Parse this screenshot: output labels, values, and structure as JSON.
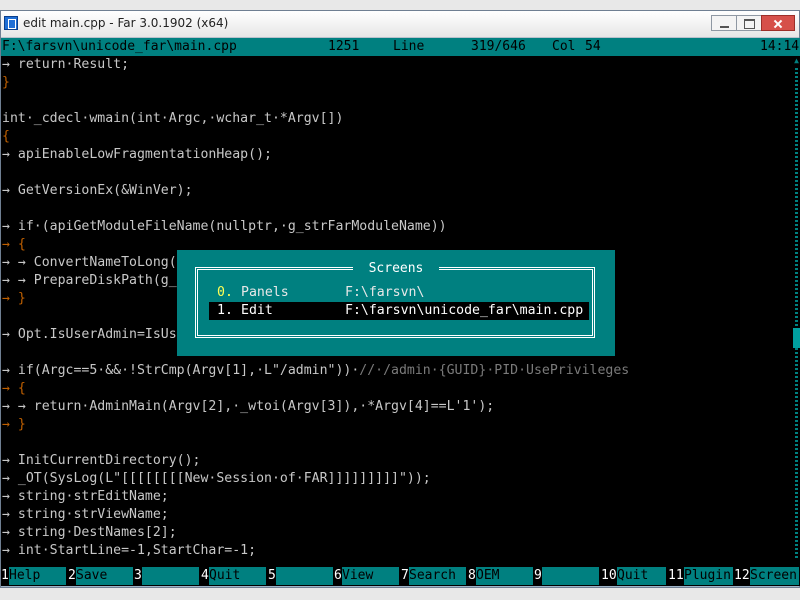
{
  "window": {
    "title": "edit main.cpp - Far 3.0.1902 (x64)"
  },
  "status_bar": {
    "path": "F:\\farsvn\\unicode_far\\main.cpp",
    "code_page": "1251",
    "line_label": "Line",
    "line_pos": "319/646",
    "col_label": "Col",
    "col_pos": "54",
    "clock": "14:14"
  },
  "code_lines": [
    "→ return·Result;",
    "}",
    "",
    "int·_cdecl·wmain(int·Argc,·wchar_t·*Argv[])",
    "{",
    "→ apiEnableLowFragmentationHeap();",
    "",
    "→ GetVersionEx(&WinVer);",
    "",
    "→ if·(apiGetModuleFileName(nullptr,·g_strFarModuleName))",
    "→ {",
    "→ → ConvertNameToLong(",
    "→ → PrepareDiskPath(g_",
    "→ }",
    "",
    "→ Opt.IsUserAdmin=IsUs",
    "",
    "→ if(Argc==5·&&·!StrCmp(Argv[1],·L\"/admin\"))·//·/admin·{GUID}·PID·UsePrivileges",
    "→ {",
    "→ → return·AdminMain(Argv[2],·_wtoi(Argv[3]),·*Argv[4]==L'1');",
    "→ }",
    "",
    "→ InitCurrentDirectory();",
    "→ _OT(SysLog(L\"[[[[[[[[New·Session·of·FAR]]]]]]]]]\"));",
    "→ string·strEditName;",
    "→ string·strViewName;",
    "→ string·DestNames[2];",
    "→ int·StartLine=-1,StartChar=-1;"
  ],
  "screens_dialog": {
    "title": "Screens",
    "items": [
      {
        "hotkey": "0.",
        "label": "Panels",
        "path": "F:\\farsvn\\"
      },
      {
        "hotkey": "1.",
        "label": "Edit",
        "path": "F:\\farsvn\\unicode_far\\main.cpp"
      }
    ],
    "selected_index": 1
  },
  "keybar": [
    {
      "num": "1",
      "label": "Help"
    },
    {
      "num": "2",
      "label": "Save"
    },
    {
      "num": "3",
      "label": ""
    },
    {
      "num": "4",
      "label": "Quit"
    },
    {
      "num": "5",
      "label": ""
    },
    {
      "num": "6",
      "label": "View"
    },
    {
      "num": "7",
      "label": "Search"
    },
    {
      "num": "8",
      "label": "OEM"
    },
    {
      "num": "9",
      "label": ""
    },
    {
      "num": "10",
      "label": "Quit"
    },
    {
      "num": "11",
      "label": "Plugin"
    },
    {
      "num": "12",
      "label": "Screen"
    }
  ],
  "colors": {
    "console_bg": "#000000",
    "accent_teal": "#008080",
    "brace_orange": "#c06000"
  }
}
